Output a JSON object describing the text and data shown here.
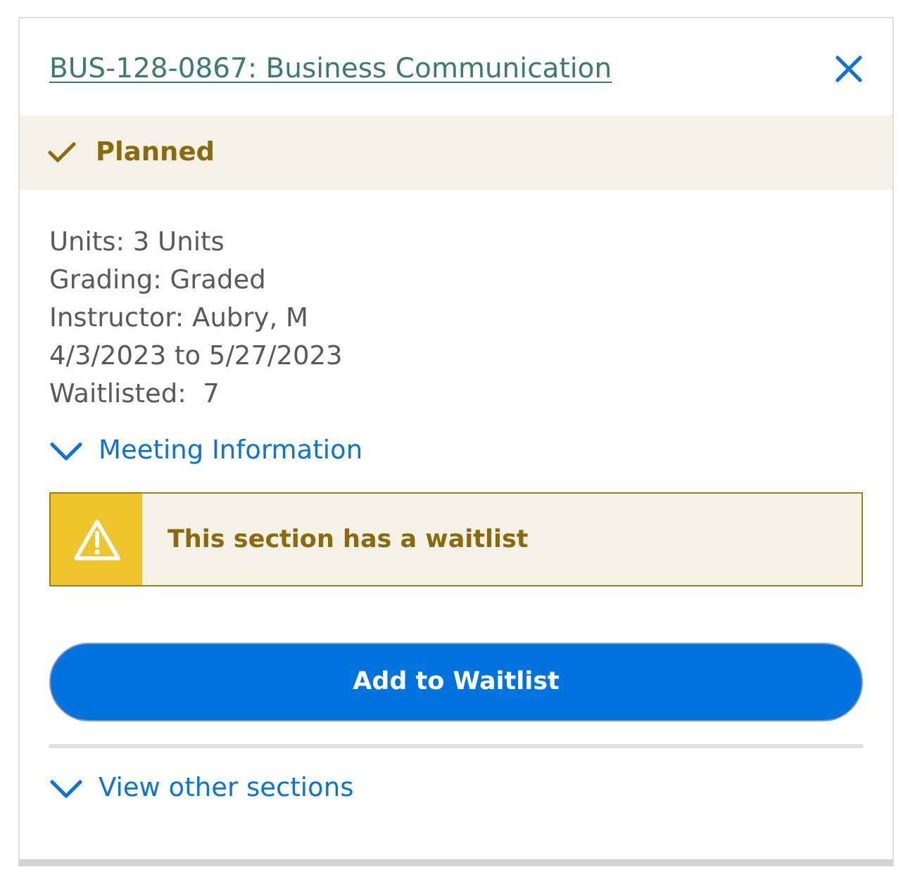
{
  "course": {
    "title": "BUS-128-0867: Business Communication"
  },
  "status": {
    "label": "Planned"
  },
  "details": [
    "Units: 3 Units",
    "Grading: Graded",
    "Instructor: Aubry, M",
    "4/3/2023 to 5/27/2023",
    "Waitlisted:  7"
  ],
  "meeting_info": {
    "label": "Meeting Information",
    "expanded": false
  },
  "alert": {
    "message": "This section has a waitlist"
  },
  "primary_button": {
    "label": "Add to Waitlist"
  },
  "other_sections": {
    "label": "View other sections",
    "expanded": false
  }
}
